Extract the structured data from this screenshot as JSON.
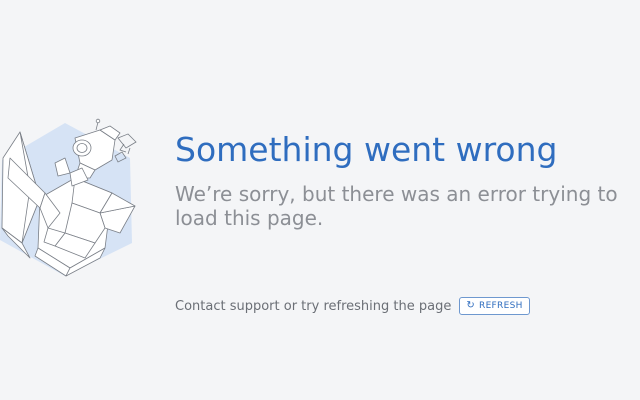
{
  "error": {
    "title": "Something went wrong",
    "message_line1": "We’re sorry, but there was an error trying to",
    "message_line2": "load this page."
  },
  "footer": {
    "text": "Contact support or try refreshing the page",
    "refresh_label": "REFRESH",
    "refresh_icon": "refresh-icon"
  },
  "colors": {
    "background": "#f4f5f7",
    "accent": "#2f6dbf",
    "hexagon": "#d6e3f5",
    "muted_text": "#8c8f95"
  }
}
